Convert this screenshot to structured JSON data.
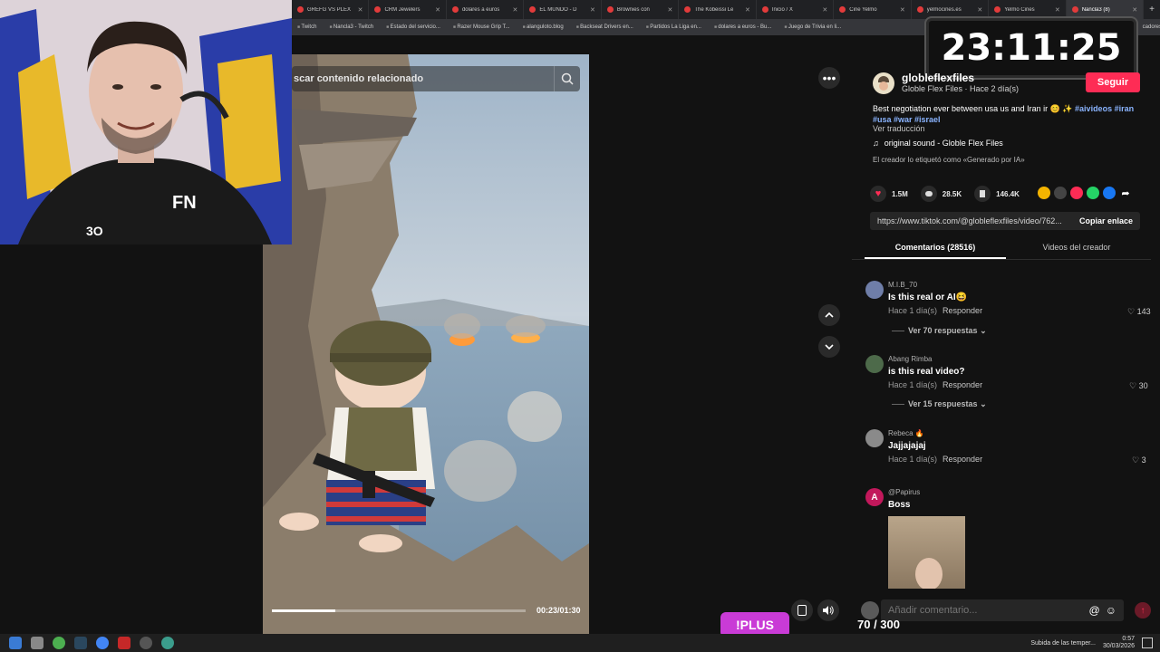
{
  "timer": "23:11:25",
  "browser": {
    "tabs": [
      {
        "label": "GREFG VS PLEX"
      },
      {
        "label": "CRM Jewelers"
      },
      {
        "label": "dolares a euros"
      },
      {
        "label": "EL MUNDO - D"
      },
      {
        "label": "Brownies con"
      },
      {
        "label": "The Kobeissi Le"
      },
      {
        "label": "Inicio / X"
      },
      {
        "label": "Cine Yelmo"
      },
      {
        "label": "yelmocines.es"
      },
      {
        "label": "Yelmo Cines"
      },
      {
        "label": "Nancla3 (8)"
      }
    ],
    "bookmarks": [
      "Twitch",
      "Nancla3 - Twitch",
      "Estado del servicio...",
      "Razer Mouse Grip T...",
      "alanguloto.blog",
      "Backseat Drivers en...",
      "Partidos La Liga en...",
      "dolares a euros - Bu...",
      "Juego de Trivia en li..."
    ],
    "bookmarks_right": "cadores"
  },
  "video": {
    "search_placeholder": "scar contenido relacionado",
    "time": "00:23/01:30",
    "progress": 0.25
  },
  "creator": {
    "handle": "globleflexfiles",
    "subtitle": "Globle Flex Files · Hace 2 día(s)",
    "follow_label": "Seguir"
  },
  "description": {
    "text": "Best negotiation ever between usa us and Iran ir 😊 ✨ ",
    "hashtags_line1": "#aivideos #iran",
    "hashtags_line2": "#usa #war #israel",
    "translate": "Ver traducción",
    "sound": "original sound - Globle Flex Files",
    "ai_label": "El creador lo etiquetó como «Generado por IA»"
  },
  "stats": {
    "likes": "1.5M",
    "comments": "28.5K",
    "saves": "146.4K"
  },
  "share_colors": [
    "#f4b400",
    "#444444",
    "#fe2c55",
    "#25d366",
    "#1877f2"
  ],
  "link": {
    "url": "https://www.tiktok.com/@globleflexfiles/video/762...",
    "copy_label": "Copiar enlace"
  },
  "tabs": {
    "comments": "Comentarios (28516)",
    "creator_videos": "Videos del creador"
  },
  "comments": [
    {
      "name": "M.I.B_70",
      "text": "Is this real or AI😆",
      "meta": "Hace 1 día(s)",
      "reply": "Responder",
      "likes": "143",
      "replies": "Ver 70 respuestas"
    },
    {
      "name": "Abang Rimba",
      "text": "is this real video?",
      "meta": "Hace 1 día(s)",
      "reply": "Responder",
      "likes": "30",
      "replies": "Ver 15 respuestas"
    },
    {
      "name": "Rebeca 🔥",
      "text": "Jajjajajaj",
      "meta": "Hace 1 día(s)",
      "reply": "Responder",
      "likes": "3"
    },
    {
      "name": "@Papirus",
      "text": "Boss",
      "avatar_letter": "A"
    }
  ],
  "comment_input_placeholder": "Añadir comentario...",
  "overlay": {
    "plus_label": "!PLUS",
    "counter": "70 / 300"
  },
  "taskbar": {
    "weather": "Subida de las temper...",
    "time": "0:57",
    "date": "30/03/2026"
  }
}
